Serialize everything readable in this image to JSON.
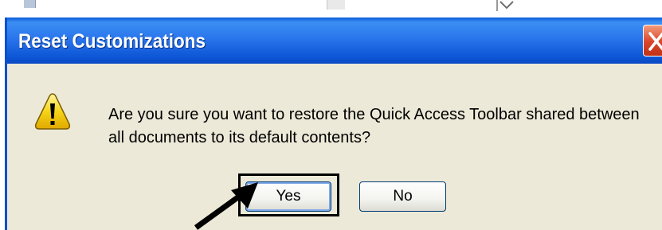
{
  "dialog": {
    "title": "Reset Customizations",
    "message": "Are you sure you want to restore the Quick Access Toolbar shared between all documents to its default contents?",
    "close_label": "X",
    "buttons": {
      "yes": "Yes",
      "no": "No"
    },
    "icon": "warning-icon"
  },
  "annotations": {
    "highlight": "highlight box around Yes button",
    "arrow": "arrow-pointer"
  },
  "colors": {
    "titlebar": "#0a5bd8",
    "dialog_bg": "#ece9d8",
    "close_button": "#d9452b",
    "warning_yellow": "#f5d418"
  }
}
